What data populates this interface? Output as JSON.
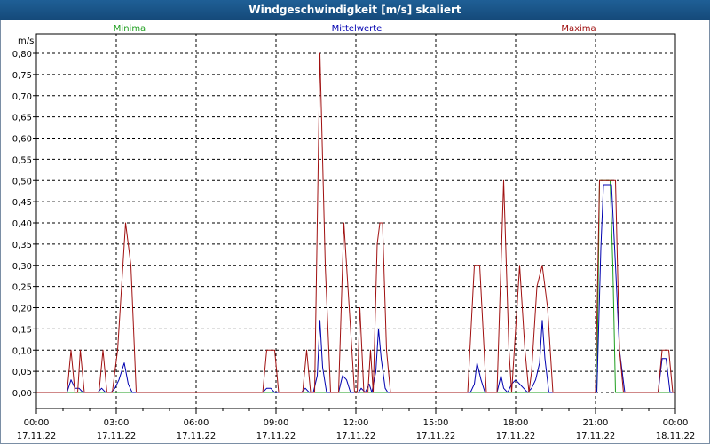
{
  "window": {
    "title": "Windgeschwindigkeit [m/s] skaliert"
  },
  "colors": {
    "minima": "#1e9e1e",
    "mittelwerte": "#0000b0",
    "maxima": "#a01010",
    "grid": "#000000"
  },
  "chart_data": {
    "type": "line",
    "title": "Windgeschwindigkeit [m/s] skaliert",
    "ylabel": "m/s",
    "ylim": [
      0,
      0.8
    ],
    "xlim": [
      0,
      24
    ],
    "y_ticks": [
      "0,00",
      "0,05",
      "0,10",
      "0,15",
      "0,20",
      "0,25",
      "0,30",
      "0,35",
      "0,40",
      "0,45",
      "0,50",
      "0,55",
      "0,60",
      "0,65",
      "0,70",
      "0,75",
      "0,80"
    ],
    "x_ticks": [
      {
        "time": "00:00",
        "date": "17.11.22"
      },
      {
        "time": "03:00",
        "date": "17.11.22"
      },
      {
        "time": "06:00",
        "date": "17.11.22"
      },
      {
        "time": "09:00",
        "date": "17.11.22"
      },
      {
        "time": "12:00",
        "date": "17.11.22"
      },
      {
        "time": "15:00",
        "date": "17.11.22"
      },
      {
        "time": "18:00",
        "date": "17.11.22"
      },
      {
        "time": "21:00",
        "date": "17.11.22"
      },
      {
        "time": "00:00",
        "date": "18.11.22"
      }
    ],
    "grid": true,
    "legend": "top",
    "series": [
      {
        "name": "Minima",
        "color": "#1e9e1e",
        "points": [
          [
            0,
            0
          ],
          [
            21.05,
            0
          ],
          [
            21.15,
            0.5
          ],
          [
            21.55,
            0.5
          ],
          [
            21.65,
            0.3
          ],
          [
            21.75,
            0
          ],
          [
            24,
            0
          ]
        ]
      },
      {
        "name": "Mittelwerte",
        "color": "#0000b0",
        "points": [
          [
            0,
            0
          ],
          [
            1.15,
            0
          ],
          [
            1.3,
            0.03
          ],
          [
            1.45,
            0.01
          ],
          [
            1.6,
            0.01
          ],
          [
            1.75,
            0
          ],
          [
            2.3,
            0
          ],
          [
            2.45,
            0.01
          ],
          [
            2.6,
            0
          ],
          [
            2.8,
            0
          ],
          [
            2.95,
            0.01
          ],
          [
            3.1,
            0.03
          ],
          [
            3.3,
            0.07
          ],
          [
            3.45,
            0.02
          ],
          [
            3.6,
            0
          ],
          [
            8.5,
            0
          ],
          [
            8.65,
            0.01
          ],
          [
            8.8,
            0.01
          ],
          [
            8.95,
            0
          ],
          [
            9.95,
            0
          ],
          [
            10.1,
            0.01
          ],
          [
            10.25,
            0
          ],
          [
            10.4,
            0
          ],
          [
            10.55,
            0.04
          ],
          [
            10.65,
            0.17
          ],
          [
            10.75,
            0.06
          ],
          [
            10.9,
            0
          ],
          [
            11.05,
            0
          ],
          [
            11.35,
            0
          ],
          [
            11.5,
            0.04
          ],
          [
            11.65,
            0.03
          ],
          [
            11.8,
            0
          ],
          [
            12.1,
            0
          ],
          [
            12.2,
            0.01
          ],
          [
            12.35,
            0
          ],
          [
            12.5,
            0.02
          ],
          [
            12.6,
            0
          ],
          [
            12.75,
            0.05
          ],
          [
            12.85,
            0.15
          ],
          [
            12.95,
            0.08
          ],
          [
            13.1,
            0.01
          ],
          [
            13.2,
            0
          ],
          [
            16.3,
            0
          ],
          [
            16.45,
            0.02
          ],
          [
            16.55,
            0.07
          ],
          [
            16.7,
            0.03
          ],
          [
            16.85,
            0
          ],
          [
            17.3,
            0
          ],
          [
            17.45,
            0.04
          ],
          [
            17.55,
            0.01
          ],
          [
            17.7,
            0
          ],
          [
            17.85,
            0.02
          ],
          [
            18.0,
            0.03
          ],
          [
            18.15,
            0.02
          ],
          [
            18.3,
            0.01
          ],
          [
            18.45,
            0
          ],
          [
            18.6,
            0.01
          ],
          [
            18.75,
            0.03
          ],
          [
            18.9,
            0.07
          ],
          [
            19.0,
            0.17
          ],
          [
            19.1,
            0.08
          ],
          [
            19.25,
            0
          ],
          [
            21.05,
            0
          ],
          [
            21.2,
            0.34
          ],
          [
            21.3,
            0.49
          ],
          [
            21.6,
            0.49
          ],
          [
            21.75,
            0.3
          ],
          [
            21.9,
            0.1
          ],
          [
            22.1,
            0
          ],
          [
            23.35,
            0
          ],
          [
            23.5,
            0.08
          ],
          [
            23.65,
            0.08
          ],
          [
            23.8,
            0
          ],
          [
            24,
            0
          ]
        ]
      },
      {
        "name": "Maxima",
        "color": "#a01010",
        "points": [
          [
            0,
            0
          ],
          [
            1.15,
            0
          ],
          [
            1.3,
            0.1
          ],
          [
            1.45,
            0
          ],
          [
            1.55,
            0
          ],
          [
            1.65,
            0.1
          ],
          [
            1.8,
            0
          ],
          [
            2.35,
            0
          ],
          [
            2.5,
            0.1
          ],
          [
            2.65,
            0
          ],
          [
            2.85,
            0
          ],
          [
            3.05,
            0.1
          ],
          [
            3.35,
            0.4
          ],
          [
            3.55,
            0.3
          ],
          [
            3.75,
            0
          ],
          [
            8.5,
            0
          ],
          [
            8.65,
            0.1
          ],
          [
            8.95,
            0.1
          ],
          [
            9.1,
            0
          ],
          [
            10.0,
            0
          ],
          [
            10.15,
            0.1
          ],
          [
            10.3,
            0
          ],
          [
            10.45,
            0
          ],
          [
            10.65,
            0.8
          ],
          [
            10.85,
            0.3
          ],
          [
            11.05,
            0
          ],
          [
            11.35,
            0
          ],
          [
            11.55,
            0.4
          ],
          [
            11.75,
            0.2
          ],
          [
            11.95,
            0
          ],
          [
            12.05,
            0
          ],
          [
            12.15,
            0.2
          ],
          [
            12.3,
            0
          ],
          [
            12.45,
            0
          ],
          [
            12.55,
            0.1
          ],
          [
            12.65,
            0
          ],
          [
            12.8,
            0.35
          ],
          [
            12.9,
            0.4
          ],
          [
            13.0,
            0.4
          ],
          [
            13.15,
            0.1
          ],
          [
            13.3,
            0
          ],
          [
            16.2,
            0
          ],
          [
            16.45,
            0.3
          ],
          [
            16.65,
            0.3
          ],
          [
            16.9,
            0
          ],
          [
            17.3,
            0
          ],
          [
            17.55,
            0.5
          ],
          [
            17.75,
            0.1
          ],
          [
            17.85,
            0
          ],
          [
            17.95,
            0.1
          ],
          [
            18.15,
            0.3
          ],
          [
            18.35,
            0.1
          ],
          [
            18.5,
            0
          ],
          [
            18.6,
            0.05
          ],
          [
            18.8,
            0.25
          ],
          [
            19.0,
            0.3
          ],
          [
            19.2,
            0.2
          ],
          [
            19.4,
            0
          ],
          [
            21.0,
            0
          ],
          [
            21.15,
            0.5
          ],
          [
            21.75,
            0.5
          ],
          [
            21.9,
            0.1
          ],
          [
            22.05,
            0
          ],
          [
            23.35,
            0
          ],
          [
            23.5,
            0.1
          ],
          [
            23.75,
            0.1
          ],
          [
            23.9,
            0
          ],
          [
            24,
            0
          ]
        ]
      }
    ]
  }
}
